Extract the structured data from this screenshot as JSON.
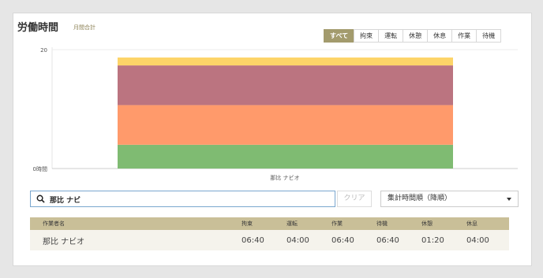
{
  "header": {
    "title": "労働時間",
    "subtitle": "月間合計"
  },
  "filters": [
    {
      "label": "すべて",
      "active": true
    },
    {
      "label": "拘束",
      "active": false
    },
    {
      "label": "運転",
      "active": false
    },
    {
      "label": "休憩",
      "active": false
    },
    {
      "label": "休息",
      "active": false
    },
    {
      "label": "作業",
      "active": false
    },
    {
      "label": "待機",
      "active": false
    }
  ],
  "chart_data": {
    "type": "bar",
    "stacked": true,
    "categories": [
      "那比 ナビオ"
    ],
    "y_tick_labels": [
      "20",
      "0時間"
    ],
    "ylim": [
      0,
      20
    ],
    "series": [
      {
        "color": "#7fbb72",
        "values": [
          4
        ]
      },
      {
        "color": "#ff9a6b",
        "values": [
          6.67
        ]
      },
      {
        "color": "#bb7480",
        "values": [
          6.67
        ]
      },
      {
        "color": "#fdd468",
        "values": [
          1.33
        ]
      }
    ]
  },
  "search": {
    "value": "那比 ナビ",
    "clear_label": "クリア"
  },
  "sort": {
    "selected": "集計時間順（降順）"
  },
  "table": {
    "headers": [
      "作業者名",
      "拘束",
      "運転",
      "作業",
      "待機",
      "休憩",
      "休息"
    ],
    "rows": [
      [
        "那比 ナビオ",
        "06:40",
        "04:00",
        "06:40",
        "06:40",
        "01:20",
        "04:00"
      ]
    ]
  }
}
